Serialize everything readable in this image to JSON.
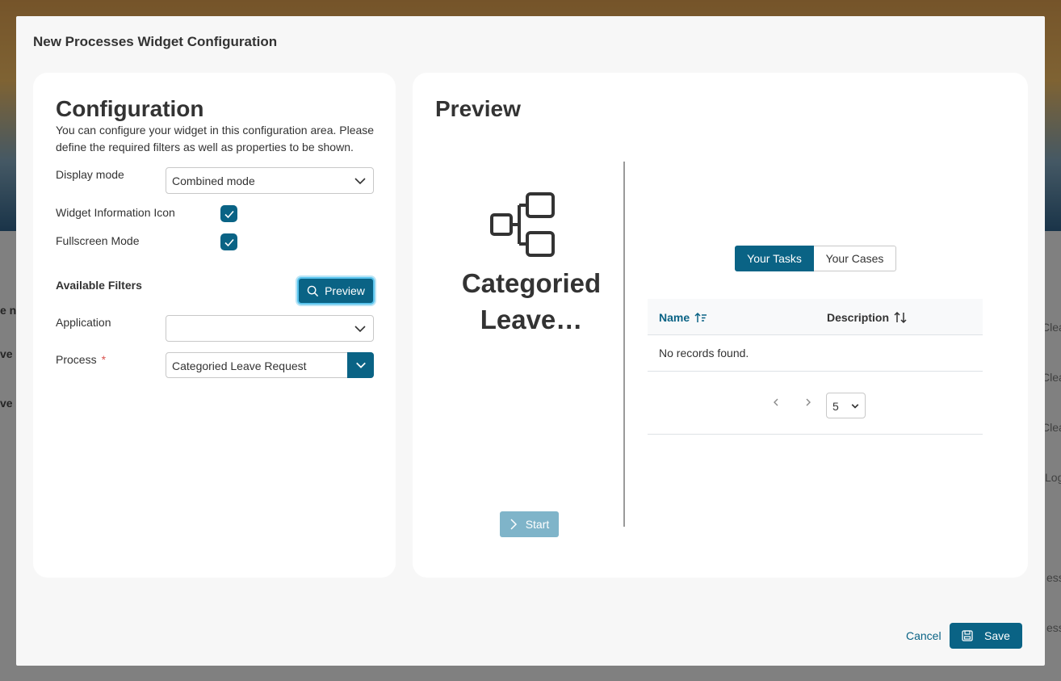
{
  "background": {
    "fragments_left": [
      "e na",
      "ve R",
      "ve R"
    ],
    "fragments_right": [
      "Clea",
      "Clea",
      "Clea",
      "Logi",
      "ess",
      "ess"
    ]
  },
  "dialog": {
    "title": "New Processes Widget Configuration"
  },
  "config": {
    "heading": "Configuration",
    "description": "You can configure your widget in this configuration area. Please define the required filters as well as properties to be shown.",
    "display_mode_label": "Display mode",
    "display_mode_value": "Combined mode",
    "info_icon_label": "Widget Information Icon",
    "fullscreen_label": "Fullscreen Mode",
    "available_filters_label": "Available Filters",
    "preview_button": "Preview",
    "application_label": "Application",
    "application_value": "",
    "process_label": "Process",
    "process_required_mark": "*",
    "process_value": "Categoried Leave Request"
  },
  "preview": {
    "heading": "Preview",
    "process_name": "Categoried Leave…",
    "start_button": "Start",
    "tabs": [
      "Your Tasks",
      "Your Cases"
    ],
    "table": {
      "columns": [
        "Name",
        "Description"
      ],
      "empty_text": "No records found."
    },
    "page_size": "5"
  },
  "footer": {
    "cancel": "Cancel",
    "save": "Save"
  },
  "colors": {
    "primary": "#0a6385",
    "start_disabled": "#7fb4c9",
    "focus_ring": "#5bc5ee"
  }
}
